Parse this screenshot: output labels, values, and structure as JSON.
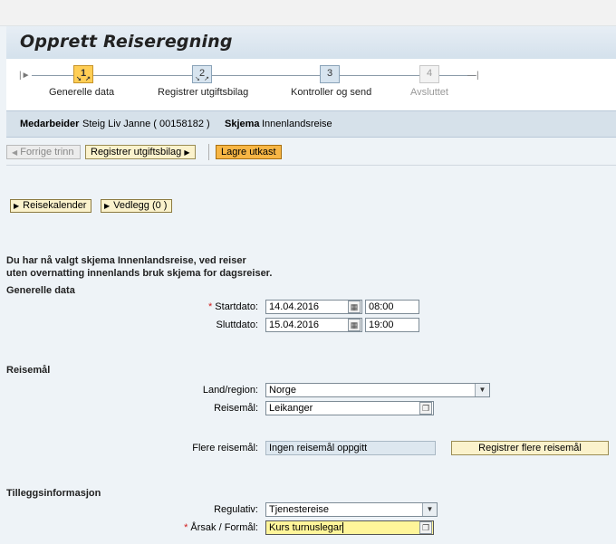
{
  "page": {
    "title": "Opprett Reiseregning"
  },
  "roadmap": {
    "steps": [
      {
        "num": "1",
        "label": "Generelle data"
      },
      {
        "num": "2",
        "label": "Registrer utgiftsbilag"
      },
      {
        "num": "3",
        "label": "Kontroller og send"
      },
      {
        "num": "4",
        "label": "Avsluttet"
      }
    ]
  },
  "info": {
    "employee_label": "Medarbeider",
    "employee_value": "Steig Liv Janne ( 00158182 )",
    "schema_label": "Skjema",
    "schema_value": "Innenlandsreise"
  },
  "toolbar": {
    "prev_label": "Forrige trinn",
    "next_label": "Registrer utgiftsbilag",
    "save_label": "Lagre utkast"
  },
  "panels": {
    "calendar_label": "Reisekalender",
    "attachments_label": "Vedlegg (0 )"
  },
  "message": {
    "line1": "Du har nå valgt skjema Innenlandsreise, ved reiser",
    "line2": "uten overnatting innenlands bruk skjema for dagsreiser."
  },
  "general": {
    "heading": "Generelle data",
    "start_label": "Startdato:",
    "start_date": "14.04.2016",
    "start_time": "08:00",
    "end_label": "Sluttdato:",
    "end_date": "15.04.2016",
    "end_time": "19:00"
  },
  "destination": {
    "heading": "Reisemål",
    "country_label": "Land/region:",
    "country_value": "Norge",
    "dest_label": "Reisemål:",
    "dest_value": "Leikanger",
    "more_label": "Flere reisemål:",
    "more_value": "Ingen reisemål oppgitt",
    "more_button": "Registrer flere reisemål"
  },
  "additional": {
    "heading": "Tilleggsinformasjon",
    "regulation_label": "Regulativ:",
    "regulation_value": "Tjenestereise",
    "reason_label": "Årsak / Formål:",
    "reason_value": "Kurs turnuslegar"
  },
  "colors": {
    "accent": "#f7b645",
    "required": "#d01c1c",
    "active_step": "#ffce55"
  }
}
